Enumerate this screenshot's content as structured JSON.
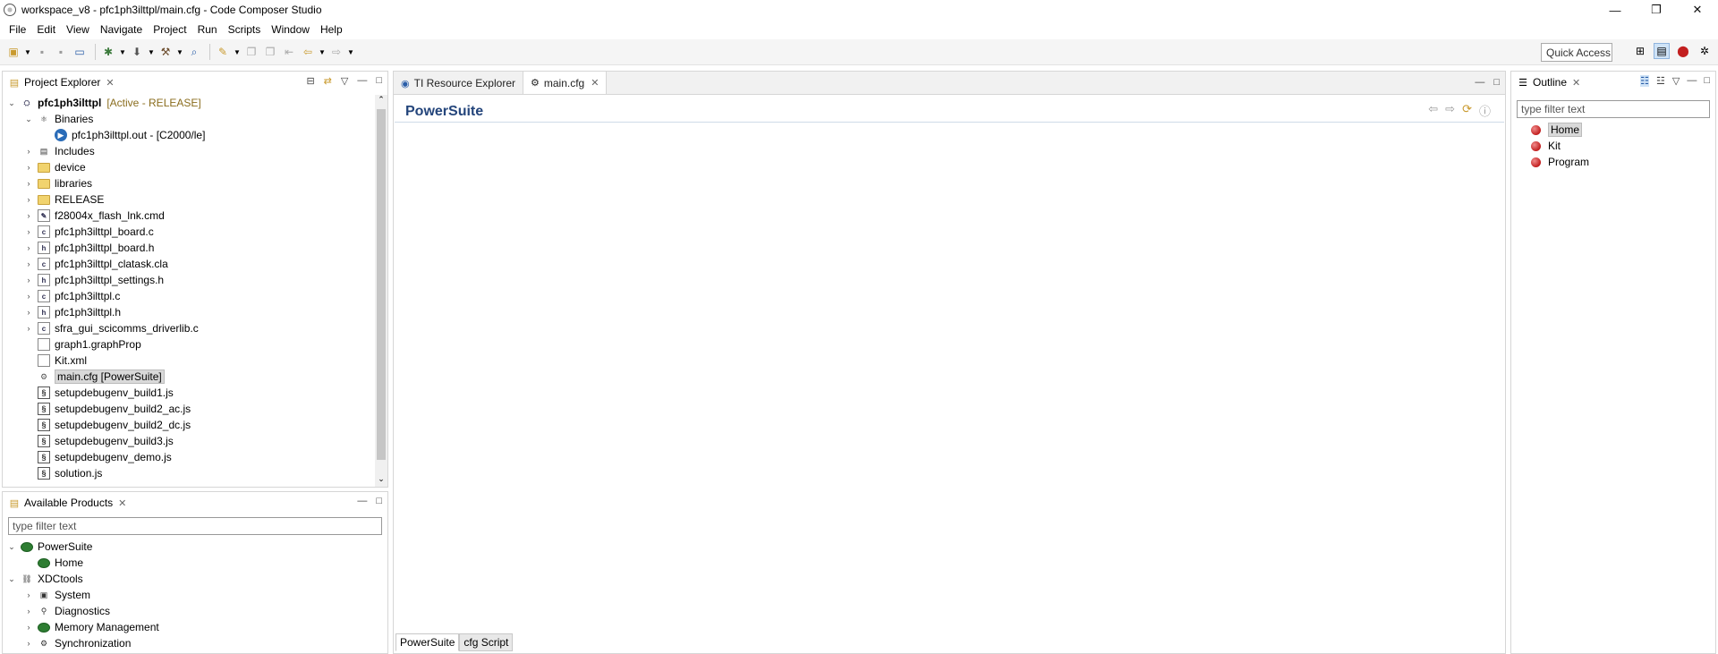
{
  "window": {
    "title": "workspace_v8 - pfc1ph3ilttpl/main.cfg - Code Composer Studio",
    "minimize": "—",
    "maximize": "❐",
    "close": "✕"
  },
  "menu": [
    "File",
    "Edit",
    "View",
    "Navigate",
    "Project",
    "Run",
    "Scripts",
    "Window",
    "Help"
  ],
  "toolbar": {
    "quick_access": "Quick Access"
  },
  "project_explorer": {
    "title": "Project Explorer",
    "project": {
      "name": "pfc1ph3ilttpl",
      "status": "[Active - RELEASE]"
    },
    "items": [
      {
        "label": "Binaries",
        "depth": 1,
        "twisty": "open",
        "icon": "binaries-icon"
      },
      {
        "label": "pfc1ph3ilttpl.out - [C2000/le]",
        "depth": 2,
        "twisty": "none",
        "icon": "executable-icon"
      },
      {
        "label": "Includes",
        "depth": 1,
        "twisty": "closed",
        "icon": "includes-icon"
      },
      {
        "label": "device",
        "depth": 1,
        "twisty": "closed",
        "icon": "folder-icon"
      },
      {
        "label": "libraries",
        "depth": 1,
        "twisty": "closed",
        "icon": "folder-icon"
      },
      {
        "label": "RELEASE",
        "depth": 1,
        "twisty": "closed",
        "icon": "folder-icon"
      },
      {
        "label": "f28004x_flash_lnk.cmd",
        "depth": 1,
        "twisty": "closed",
        "icon": "cmd-file-icon"
      },
      {
        "label": "pfc1ph3ilttpl_board.c",
        "depth": 1,
        "twisty": "closed",
        "icon": "c-file-icon"
      },
      {
        "label": "pfc1ph3ilttpl_board.h",
        "depth": 1,
        "twisty": "closed",
        "icon": "h-file-icon"
      },
      {
        "label": "pfc1ph3ilttpl_clatask.cla",
        "depth": 1,
        "twisty": "closed",
        "icon": "c-file-icon"
      },
      {
        "label": "pfc1ph3ilttpl_settings.h",
        "depth": 1,
        "twisty": "closed",
        "icon": "h-file-icon"
      },
      {
        "label": "pfc1ph3ilttpl.c",
        "depth": 1,
        "twisty": "closed",
        "icon": "c-file-icon"
      },
      {
        "label": "pfc1ph3ilttpl.h",
        "depth": 1,
        "twisty": "closed",
        "icon": "h-file-icon"
      },
      {
        "label": "sfra_gui_scicomms_driverlib.c",
        "depth": 1,
        "twisty": "closed",
        "icon": "c-file-icon"
      },
      {
        "label": "graph1.graphProp",
        "depth": 1,
        "twisty": "none",
        "icon": "file-icon"
      },
      {
        "label": "Kit.xml",
        "depth": 1,
        "twisty": "none",
        "icon": "file-icon"
      },
      {
        "label": "main.cfg [PowerSuite]",
        "depth": 1,
        "twisty": "none",
        "icon": "cfg-file-icon",
        "selected": true
      },
      {
        "label": "setupdebugenv_build1.js",
        "depth": 1,
        "twisty": "none",
        "icon": "js-file-icon"
      },
      {
        "label": "setupdebugenv_build2_ac.js",
        "depth": 1,
        "twisty": "none",
        "icon": "js-file-icon"
      },
      {
        "label": "setupdebugenv_build2_dc.js",
        "depth": 1,
        "twisty": "none",
        "icon": "js-file-icon"
      },
      {
        "label": "setupdebugenv_build3.js",
        "depth": 1,
        "twisty": "none",
        "icon": "js-file-icon"
      },
      {
        "label": "setupdebugenv_demo.js",
        "depth": 1,
        "twisty": "none",
        "icon": "js-file-icon"
      },
      {
        "label": "solution.js",
        "depth": 1,
        "twisty": "none",
        "icon": "js-file-icon"
      }
    ]
  },
  "available_products": {
    "title": "Available Products",
    "filter_placeholder": "type filter text",
    "items": [
      {
        "label": "PowerSuite",
        "depth": 0,
        "twisty": "open",
        "icon": "product-icon"
      },
      {
        "label": "Home",
        "depth": 1,
        "twisty": "none",
        "icon": "product-icon"
      },
      {
        "label": "XDCtools",
        "depth": 0,
        "twisty": "open",
        "icon": "xdctools-icon"
      },
      {
        "label": "System",
        "depth": 1,
        "twisty": "closed",
        "icon": "system-icon"
      },
      {
        "label": "Diagnostics",
        "depth": 1,
        "twisty": "closed",
        "icon": "diagnostics-icon"
      },
      {
        "label": "Memory Management",
        "depth": 1,
        "twisty": "closed",
        "icon": "memory-icon"
      },
      {
        "label": "Synchronization",
        "depth": 1,
        "twisty": "closed",
        "icon": "sync-icon"
      }
    ]
  },
  "editor": {
    "tabs": [
      {
        "label": "TI Resource Explorer",
        "active": false
      },
      {
        "label": "main.cfg",
        "active": true
      }
    ],
    "form_title": "PowerSuite",
    "bottom_tabs": [
      {
        "label": "PowerSuite",
        "active": true
      },
      {
        "label": "cfg Script",
        "active": false
      }
    ]
  },
  "outline": {
    "title": "Outline",
    "filter_placeholder": "type filter text",
    "items": [
      {
        "label": "Home",
        "selected": true
      },
      {
        "label": "Kit",
        "selected": false
      },
      {
        "label": "Program",
        "selected": false
      }
    ]
  }
}
